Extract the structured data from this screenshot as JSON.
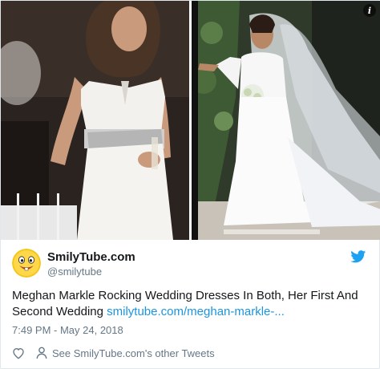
{
  "tweet": {
    "account_name": "SmilyTube.com",
    "handle": "@smilytube",
    "text": "Meghan Markle Rocking Wedding Dresses In Both, Her First And Second Wedding ",
    "link_text": "smilytube.com/meghan-markle-...",
    "timestamp": "7:49 PM - May 24, 2018",
    "see_other_tweets": "See SmilyTube.com's other Tweets"
  },
  "media": {
    "info_icon_glyph": "i",
    "left_photo_icon": "photo-strapless-dress",
    "right_photo_icon": "photo-wedding-veil"
  },
  "icons": {
    "brand": "twitter-bird-icon",
    "like": "heart-icon",
    "profile": "person-icon",
    "avatar": "smiley-avatar"
  },
  "colors": {
    "text": "#14171a",
    "secondary_text": "#657786",
    "link": "#1b95e0",
    "twitter_blue": "#1da1f2",
    "avatar_yellow": "#f5c518"
  }
}
